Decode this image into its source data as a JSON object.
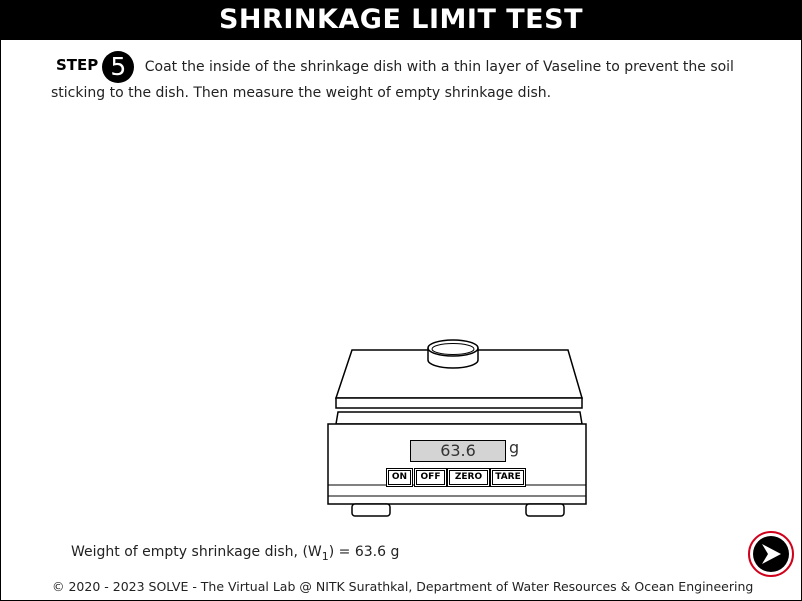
{
  "header": {
    "title": "SHRINKAGE LIMIT TEST"
  },
  "step": {
    "label": "STEP",
    "number": "5",
    "text_line1": "Coat the inside of the shrinkage dish with a thin layer of Vaseline to prevent the soil",
    "text_line2": "sticking to the dish. Then measure the weight of empty shrinkage dish."
  },
  "scale": {
    "reading": "63.6",
    "unit": "g",
    "buttons": {
      "on": "ON",
      "off": "OFF",
      "zero": "ZERO",
      "tare": "TARE"
    }
  },
  "result": {
    "prefix": "Weight of empty shrinkage dish, (W",
    "subscript": "1",
    "suffix": ") = 63.6 g"
  },
  "footer": {
    "text": "© 2020 - 2023 SOLVE - The Virtual Lab @ NITK Surathkal, Department of Water Resources & Ocean Engineering"
  },
  "next_button": {
    "icon": "arrow-right-icon",
    "accent_color": "#d0021b"
  }
}
